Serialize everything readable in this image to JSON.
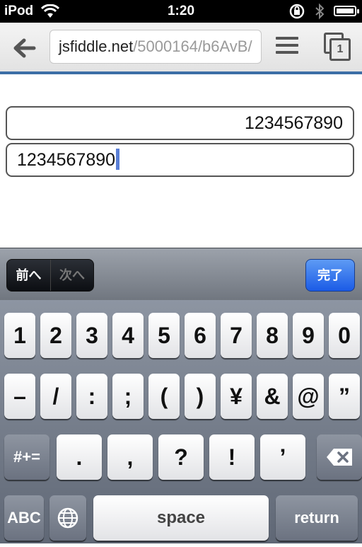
{
  "status_bar": {
    "carrier": "iPod",
    "time": "1:20"
  },
  "toolbar": {
    "url_host": "jsfiddle.net",
    "url_path": "/5000164/b6AvB/",
    "tab_count": "1"
  },
  "form": {
    "field_1_value": "1234567890",
    "field_2_value": "1234567890"
  },
  "accessory": {
    "prev_label": "前へ",
    "next_label": "次へ",
    "done_label": "完了"
  },
  "keyboard": {
    "row1": [
      "1",
      "2",
      "3",
      "4",
      "5",
      "6",
      "7",
      "8",
      "9",
      "0"
    ],
    "row2": [
      "–",
      "/",
      ":",
      ";",
      "(",
      ")",
      "¥",
      "&",
      "@",
      "”"
    ],
    "row3": [
      ".",
      ",",
      "?",
      "!",
      "’"
    ],
    "symbols_label": "#+=",
    "abc_label": "ABC",
    "space_label": "space",
    "return_label": "return"
  }
}
